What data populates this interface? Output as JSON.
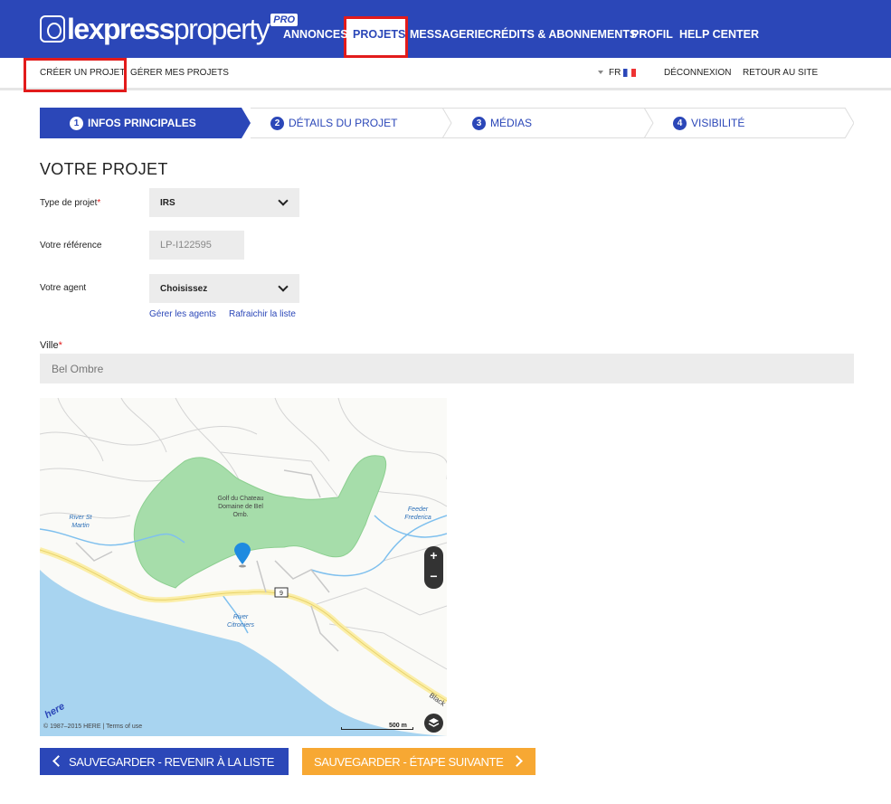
{
  "brand": {
    "name_light": "lexpress",
    "name_rest": "property",
    "badge": "PRO"
  },
  "nav": {
    "items": [
      {
        "label": "ANNONCES"
      },
      {
        "label": "PROJETS"
      },
      {
        "label": "MESSAGERIE"
      },
      {
        "label": "CRÉDITS & ABONNEMENTS"
      },
      {
        "label": "PROFIL"
      },
      {
        "label": "HELP CENTER"
      }
    ],
    "active": "PROJETS"
  },
  "subnav": {
    "create": "CRÉER UN PROJET",
    "manage": "GÉRER MES PROJETS",
    "lang": "FR",
    "logout": "DÉCONNEXION",
    "back": "RETOUR AU SITE"
  },
  "steps": [
    {
      "num": "1",
      "label": "INFOS PRINCIPALES"
    },
    {
      "num": "2",
      "label": "DÉTAILS DU PROJET"
    },
    {
      "num": "3",
      "label": "MÉDIAS"
    },
    {
      "num": "4",
      "label": "VISIBILITÉ"
    }
  ],
  "form": {
    "title": "VOTRE PROJET",
    "type_label": "Type de projet",
    "type_value": "IRS",
    "ref_label": "Votre référence",
    "ref_value": "LP-I122595",
    "agent_label": "Votre agent",
    "agent_value": "Choisissez",
    "manage_agents": "Gérer les agents",
    "refresh_list": "Rafraichir la liste",
    "city_label": "Ville",
    "city_value": "Bel Ombre",
    "required_mark": "*"
  },
  "map": {
    "labels": {
      "golf": [
        "Golf du Chateau",
        "Domaine de Bel",
        "Omb."
      ],
      "river_st_martin": [
        "River St",
        "Martin"
      ],
      "feeder": [
        "Feeder",
        "Frederica"
      ],
      "river_citroniers": [
        "River",
        "Citroniers"
      ],
      "road_number": "9",
      "black": "Black"
    },
    "copyright": "© 1987–2015 HERE | Terms of use",
    "scale": "500 m",
    "zoom_in": "+",
    "zoom_out": "−",
    "provider": "here"
  },
  "buttons": {
    "back": "SAUVEGARDER - REVENIR À LA LISTE",
    "next": "SAUVEGARDER - ÉTAPE SUIVANTE"
  },
  "colors": {
    "brand_blue": "#2b47b8",
    "accent_orange": "#f7a833",
    "highlight_red": "#e21b1b"
  }
}
